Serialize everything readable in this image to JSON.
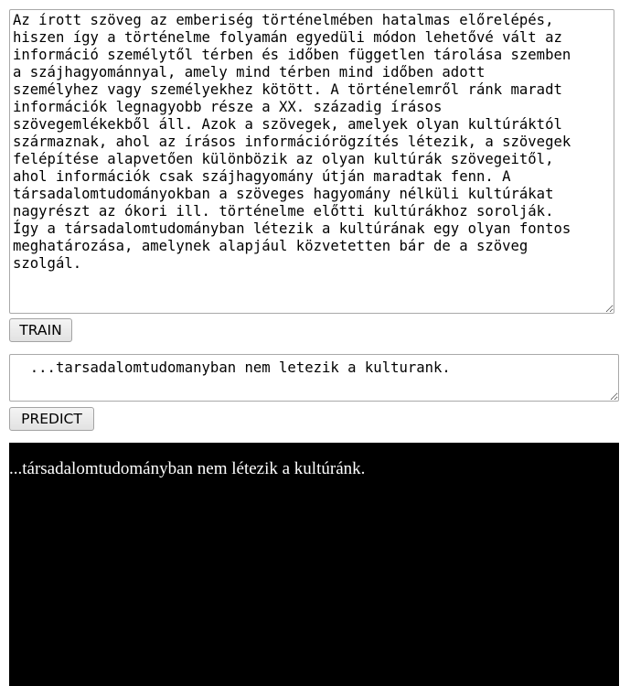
{
  "train": {
    "text": "Az írott szöveg az emberiség történelmében hatalmas előrelépés,\nhiszen így a történelme folyamán egyedüli módon lehetővé vált az\ninformáció személytől térben és időben független tárolása szemben\na szájhagyománnyal, amely mind térben mind időben adott\nszemélyhez vagy személyekhez kötött. A történelemről ránk maradt\ninformációk legnagyobb része a XX. századig írásos\nszövegemlékekből áll. Azok a szövegek, amelyek olyan kultúráktól\nszármaznak, ahol az írásos információrögzítés létezik, a szövegek\nfelépítése alapvetően különbözik az olyan kultúrák szövegeitől,\nahol információk csak szájhagyomány útján maradtak fenn. A\ntársadalomtudományokban a szöveges hagyomány nélküli kultúrákat\nnagyrészt az ókori ill. történelme előtti kultúrákhoz sorolják.\nÍgy a társadalomtudományban létezik a kultúrának egy olyan fontos\nmeghatározása, amelynek alapjául közvetetten bár de a szöveg\nszolgál.",
    "button_label": "TRAIN"
  },
  "predict": {
    "input_text": "  ...tarsadalomtudomanyban nem letezik a kulturank.",
    "button_label": "PREDICT"
  },
  "output": {
    "text": "...társadalomtudományban nem létezik a kultúránk."
  }
}
